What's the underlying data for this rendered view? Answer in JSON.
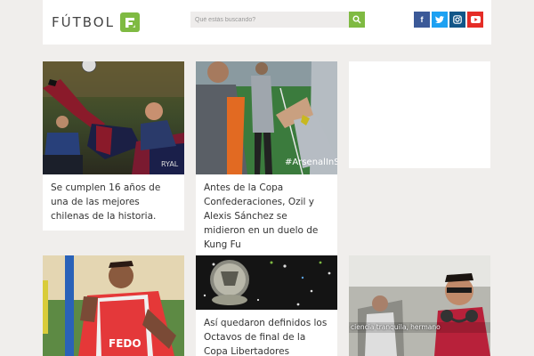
{
  "header": {
    "logo_text": "FÚTBOL",
    "search_placeholder": "Qué estás buscando?",
    "social": [
      {
        "name": "facebook",
        "glyph": "f"
      },
      {
        "name": "twitter",
        "glyph": "t"
      },
      {
        "name": "instagram",
        "glyph": "◘"
      },
      {
        "name": "youtube",
        "glyph": "▶"
      }
    ],
    "colors": {
      "accent": "#7fba42",
      "facebook": "#3b5998",
      "twitter": "#1da1f2",
      "instagram": "#125688",
      "youtube": "#e52d27"
    }
  },
  "articles": [
    {
      "title": "Se cumplen 16 años de una de las mejores chilenas de la historia.",
      "image_caption": ""
    },
    {
      "title": "Antes de la Copa Confederaciones, Ozil y Alexis Sánchez se midieron en un duelo de Kung Fu",
      "image_caption": "#ArsenalInSh"
    },
    {
      "title": "Así quedaron definidos los Octavos de final de la Copa Libertadores",
      "image_caption": ""
    },
    {
      "title": "",
      "image_caption": "ciencia tranquila, hermano"
    }
  ],
  "player_jersey_text": "FEDO",
  "player_jersey_number": "RYAL"
}
